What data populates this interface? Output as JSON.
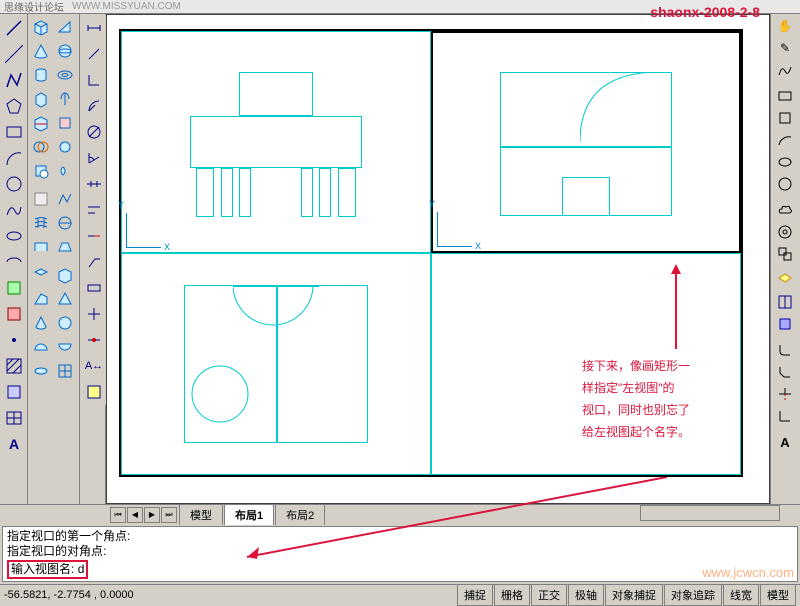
{
  "titlebar": {
    "logo": "思缘设计论坛",
    "url": "WWW.MISSYUAN.COM"
  },
  "watermark": {
    "top_right": "shaonx-2008-2-8",
    "bottom_right": "www.jcwcn.com"
  },
  "tabs": {
    "model": "模型",
    "layout1": "布局1",
    "layout2": "布局2"
  },
  "command": {
    "line1": "指定视口的第一个角点:",
    "line2": "指定视口的对角点:",
    "prompt": "输入视图名:",
    "input": "d"
  },
  "status": {
    "coords": "-56.5821, -2.7754 , 0.0000",
    "buttons": [
      "捕捉",
      "栅格",
      "正交",
      "极轴",
      "对象捕捉",
      "对象追踪",
      "线宽",
      "模型"
    ]
  },
  "annotation": {
    "l1": "接下来，像画矩形一",
    "l2": "样指定\"左视图\"的",
    "l3": "视口，同时也别忘了",
    "l4": "给左视图起个名字。"
  },
  "ucs": {
    "x": "X",
    "y": "Y"
  },
  "left_tools_a": [
    "line",
    "xline",
    "pline",
    "polygon",
    "rect",
    "arc",
    "circle",
    "spline",
    "ellipse",
    "earc",
    "insert",
    "block",
    "point",
    "hatch",
    "region",
    "table",
    "mtext"
  ],
  "left_tools_b": [
    "3dbox",
    "wedge",
    "cone",
    "sphere",
    "cyl",
    "torus",
    "ext",
    "rev",
    "slice",
    "sect",
    "inter",
    "union",
    "sub",
    "int2",
    "setup",
    "3dpoly",
    "mesh",
    "rsurf",
    "tsurf",
    "esurf",
    "3dface"
  ],
  "right_tools": [
    "pan",
    "zoom",
    "zoomw",
    "zoomp",
    "3dorbit",
    "dist",
    "area",
    "list",
    "id",
    "ucs",
    "ucsp",
    "view",
    "vp",
    "render",
    "hide",
    "shade",
    "mat",
    "light",
    "scene",
    "bg",
    "fog",
    "ls",
    "text"
  ]
}
